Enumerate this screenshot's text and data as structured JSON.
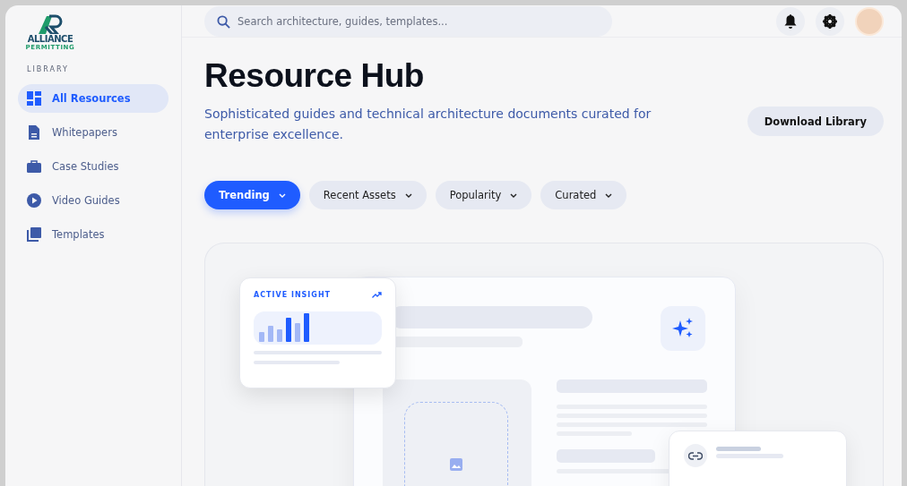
{
  "brand": {
    "name": "ALLIANCE",
    "tagline": "PERMITTING"
  },
  "sidebar": {
    "section": "LIBRARY",
    "items": [
      {
        "label": "All Resources",
        "selected": true
      },
      {
        "label": "Whitepapers",
        "selected": false
      },
      {
        "label": "Case Studies",
        "selected": false
      },
      {
        "label": "Video Guides",
        "selected": false
      },
      {
        "label": "Templates",
        "selected": false
      }
    ]
  },
  "search": {
    "placeholder": "Search architecture, guides, templates..."
  },
  "page": {
    "title": "Resource Hub",
    "subtitle": "Sophisticated guides and technical architecture documents curated for enterprise excellence.",
    "action": "Download Library"
  },
  "filters": [
    {
      "label": "Trending",
      "selected": true
    },
    {
      "label": "Recent Assets",
      "selected": false
    },
    {
      "label": "Popularity",
      "selected": false
    },
    {
      "label": "Curated",
      "selected": false
    }
  ],
  "insight_card": {
    "label": "ACTIVE INSIGHT"
  }
}
